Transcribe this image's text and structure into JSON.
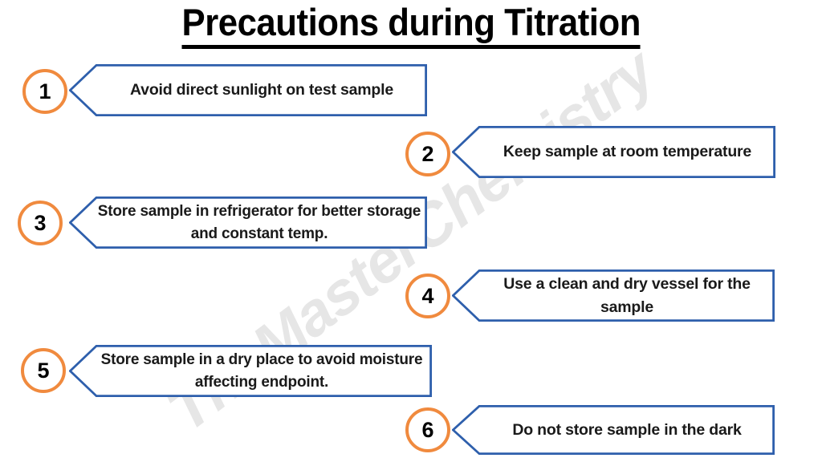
{
  "title": "Precautions during Titration",
  "watermark": "TheMasterChemistry",
  "colors": {
    "badge_ring": "#F08A3E",
    "banner_border": "#2E5FAC",
    "banner_fill": "#FFFFFF",
    "text": "#1A1A1A",
    "title": "#000000",
    "watermark": "#E6E6E6",
    "background": "#FFFFFF"
  },
  "items": [
    {
      "number": "1",
      "text": "Avoid direct sunlight on test sample",
      "side": "left"
    },
    {
      "number": "2",
      "text": "Keep sample at room temperature",
      "side": "right"
    },
    {
      "number": "3",
      "text": "Store sample in refrigerator for better storage and constant temp.",
      "side": "left"
    },
    {
      "number": "4",
      "text": "Use a clean and dry vessel for the sample",
      "side": "right"
    },
    {
      "number": "5",
      "text": "Store sample in a dry place to avoid moisture affecting endpoint.",
      "side": "left"
    },
    {
      "number": "6",
      "text": "Do not store sample in the dark",
      "side": "right"
    }
  ]
}
